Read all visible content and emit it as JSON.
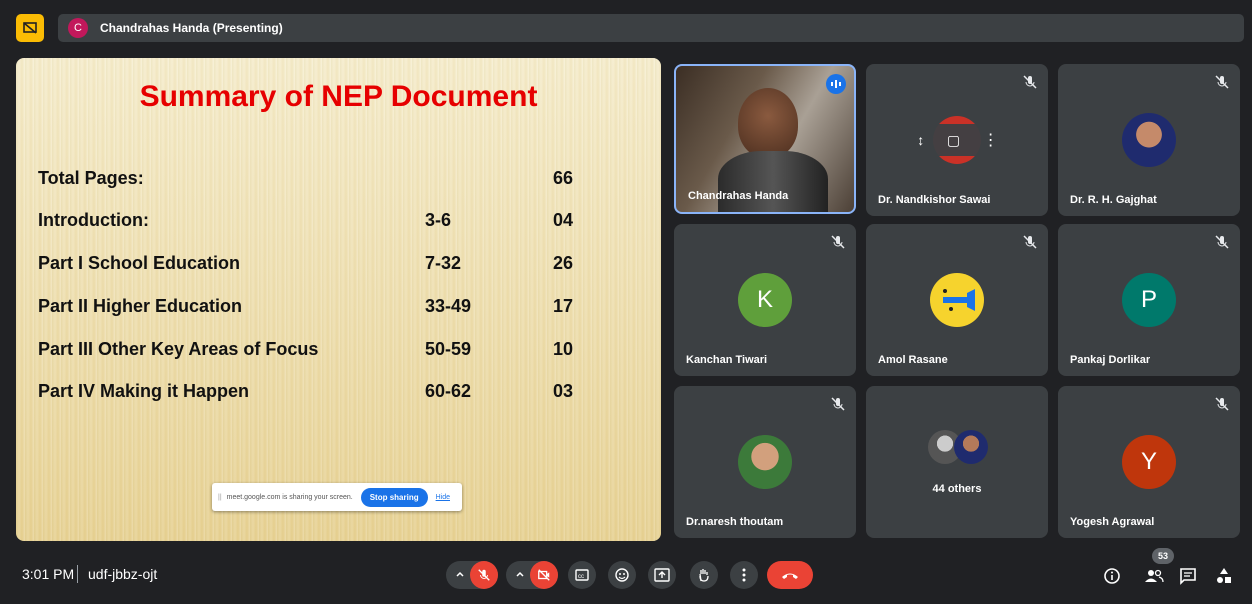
{
  "presenter_bar": {
    "initial": "C",
    "label": "Chandrahas Handa (Presenting)"
  },
  "slide": {
    "title": "Summary of NEP Document",
    "rows": [
      {
        "label": "Total Pages:",
        "range": "",
        "count": "66"
      },
      {
        "label": "Introduction:",
        "range": "3-6",
        "count": "04"
      },
      {
        "label": "Part I School Education",
        "range": "7-32",
        "count": "26"
      },
      {
        "label": "Part II Higher Education",
        "range": "33-49",
        "count": "17"
      },
      {
        "label": "Part III Other Key Areas of Focus",
        "range": "50-59",
        "count": "10"
      },
      {
        "label": "Part IV Making it Happen",
        "range": "60-62",
        "count": "03"
      }
    ]
  },
  "share_bar": {
    "message": "meet.google.com is sharing your screen.",
    "stop_label": "Stop sharing",
    "hide_label": "Hide"
  },
  "participants": [
    {
      "name": "Chandrahas Handa",
      "type": "video"
    },
    {
      "name": "Dr. Nandkishor Sawai",
      "type": "hover"
    },
    {
      "name": "Dr. R. H. Gajghat",
      "type": "photo"
    },
    {
      "name": "Kanchan Tiwari",
      "initial": "K",
      "color": "#5f9f3b"
    },
    {
      "name": "Amol Rasane",
      "type": "photo-yellow"
    },
    {
      "name": "Pankaj Dorlikar",
      "initial": "P",
      "color": "#00796b"
    },
    {
      "name": "Dr.naresh thoutam",
      "type": "photo"
    },
    {
      "name": "44 others",
      "type": "group"
    },
    {
      "name": "Yogesh Agrawal",
      "initial": "Y",
      "color": "#bf360c"
    }
  ],
  "bottom_bar": {
    "time": "3:01 PM",
    "meeting_code": "udf-jbbz-ojt",
    "participant_count": "53"
  },
  "colors": {
    "accent": "#1a73e8",
    "danger": "#ea4335",
    "slide_title": "#e60000"
  }
}
